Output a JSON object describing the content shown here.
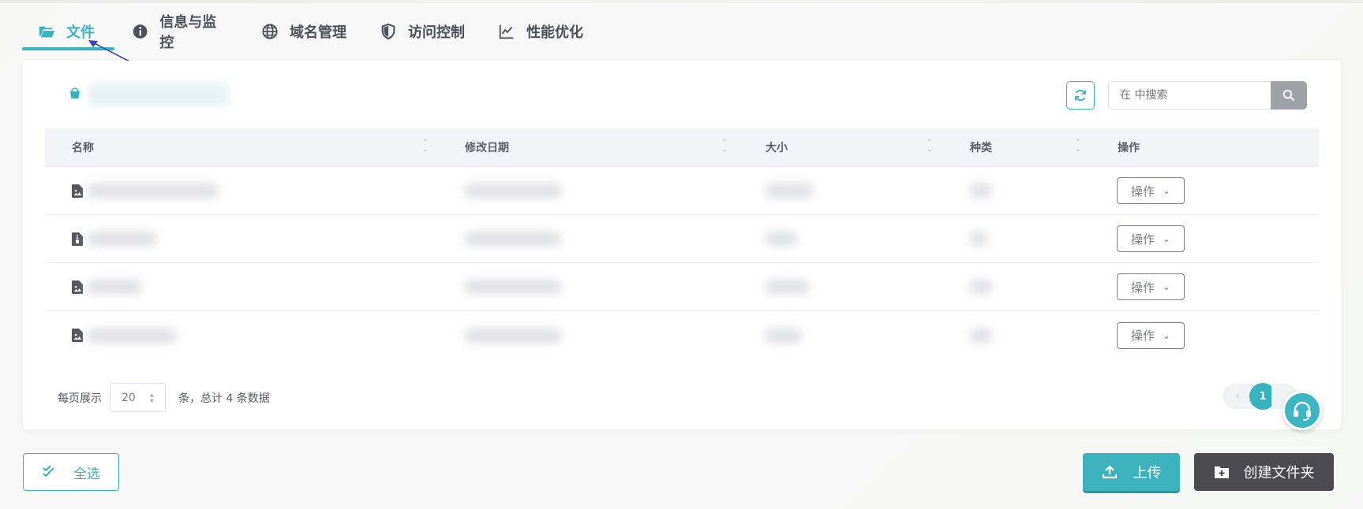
{
  "tabs": [
    {
      "label": "文件",
      "icon": "folder-open-icon",
      "active": true
    },
    {
      "label": "信息与监控",
      "icon": "info-icon",
      "active": false
    },
    {
      "label": "域名管理",
      "icon": "globe-icon",
      "active": false
    },
    {
      "label": "访问控制",
      "icon": "shield-icon",
      "active": false
    },
    {
      "label": "性能优化",
      "icon": "line-chart-icon",
      "active": false
    }
  ],
  "toolbar": {
    "search_placeholder": "在 中搜索"
  },
  "table": {
    "headers": [
      "名称",
      "修改日期",
      "大小",
      "种类",
      "操作"
    ],
    "rows": [
      {
        "file_icon": "image-file-icon",
        "action_label": "操作"
      },
      {
        "file_icon": "zip-file-icon",
        "action_label": "操作"
      },
      {
        "file_icon": "image-file-icon",
        "action_label": "操作"
      },
      {
        "file_icon": "image-file-icon",
        "action_label": "操作"
      }
    ]
  },
  "pagination": {
    "per_page_label": "每页展示",
    "page_size": "20",
    "total_text": "条，总计 4 条数据",
    "current_page": "1",
    "prev_symbol": "‹"
  },
  "actions": {
    "select_all": "全选",
    "upload": "上传",
    "create_folder": "创建文件夹"
  },
  "colors": {
    "accent": "#37b3c0",
    "dark_button": "#4b4b4f",
    "search_button": "#9ea1a6"
  }
}
